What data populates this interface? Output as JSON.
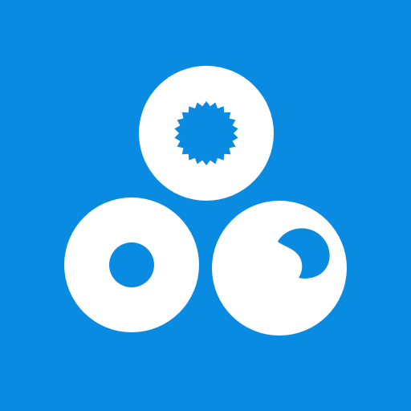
{
  "icon": {
    "name": "three-cells-icon",
    "colors": {
      "background": "#0A8BE2",
      "shape": "#FFFFFF"
    }
  }
}
